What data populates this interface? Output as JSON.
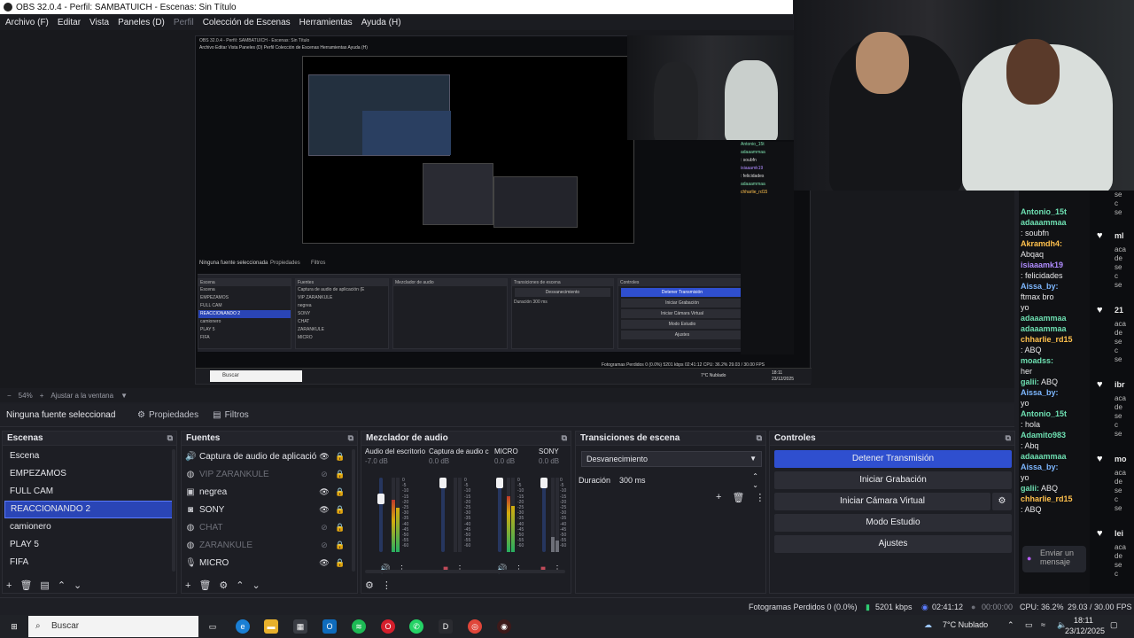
{
  "window": {
    "title": "OBS 32.0.4 - Perfil: SAMBATUICH - Escenas: Sin Título"
  },
  "menu": [
    "Archivo (F)",
    "Editar",
    "Vista",
    "Paneles (D)",
    "Perfil",
    "Colección de Escenas",
    "Herramientas",
    "Ayuda (H)"
  ],
  "nested": {
    "title": "OBS 32.0.4 - Perfil: SAMBATUICH - Escenas: Sin Título",
    "menu": "Archivo  Editar  Vista  Paneles (D)  Perfil  Colección de Escenas  Herramientas  Ayuda (H)",
    "no_source": "Ninguna fuente seleccionada",
    "properties": "Propiedades",
    "filters": "Filtros",
    "scenes_title": "Escena",
    "scenes": [
      "Escena",
      "EMPEZAMOS",
      "FULL CAM",
      "REACCIONANDO 2",
      "camionero",
      "PLAY 5",
      "FIFA"
    ],
    "sources_title": "Fuentes",
    "sources": [
      "Captura de audio de aplicación (E",
      "VIP ZARANKULE",
      "negrea",
      "SONY",
      "CHAT",
      "ZARANKULE",
      "MICRO"
    ],
    "mixer_title": "Mezclador de audio",
    "transitions_title": "Transiciones de escena",
    "transition": "Desvanecimiento",
    "duration_label": "Duración",
    "duration": "300 ms",
    "controls_title": "Controles",
    "controls": [
      "Detener Transmisión",
      "Iniciar Grabación",
      "Iniciar Cámara Virtual",
      "Modo Estudio",
      "Ajustes"
    ],
    "status": "Fotogramas Perdidos 0 (0.0%)   5201 kbps   02:41:12   CPU: 36.2%   29.03 / 30.00 FPS",
    "search": "Buscar",
    "weather": "7°C  Nublado",
    "time": "18:11",
    "date": "23/12/2025"
  },
  "zoom": {
    "value": "54%",
    "fit": "Ajustar a la ventana"
  },
  "filterbar": {
    "no_source": "Ninguna fuente seleccionad",
    "properties": "Propiedades",
    "filters": "Filtros"
  },
  "scenes": {
    "title": "Escenas",
    "items": [
      "Escena",
      "EMPEZAMOS",
      "FULL CAM",
      "REACCIONANDO 2",
      "camionero",
      "PLAY 5",
      "FIFA"
    ],
    "selected": "REACCIONANDO 2"
  },
  "sources": {
    "title": "Fuentes",
    "items": [
      {
        "name": "Captura de audio de aplicación (E",
        "icon": "speaker-icon",
        "visible": true
      },
      {
        "name": "VIP ZARANKULE",
        "icon": "globe-icon",
        "visible": false
      },
      {
        "name": "negrea",
        "icon": "image-icon",
        "visible": true
      },
      {
        "name": "SONY",
        "icon": "camera-icon",
        "visible": true
      },
      {
        "name": "CHAT",
        "icon": "globe-icon",
        "visible": false
      },
      {
        "name": "ZARANKULE",
        "icon": "globe-icon",
        "visible": false
      },
      {
        "name": "MICRO",
        "icon": "microphone-icon",
        "visible": true
      }
    ]
  },
  "mixer": {
    "title": "Mezclador de audio",
    "channels": [
      {
        "name": "Audio del escritorio",
        "db": "-7.0 dB",
        "level": 0.55,
        "muted": false
      },
      {
        "name": "Captura de audio c",
        "db": "0.0 dB",
        "level": 0.0,
        "muted": true
      },
      {
        "name": "MICRO",
        "db": "0.0 dB",
        "level": 0.7,
        "muted": false
      },
      {
        "name": "SONY",
        "db": "0.0 dB",
        "level": 0.0,
        "muted": true
      }
    ],
    "scale": [
      "0",
      "-5",
      "-10",
      "-15",
      "-20",
      "-25",
      "-30",
      "-35",
      "-40",
      "-45",
      "-50",
      "-55",
      "-60"
    ]
  },
  "transitions": {
    "title": "Transiciones de escena",
    "selected": "Desvanecimiento",
    "duration_label": "Duración",
    "duration": "300 ms"
  },
  "controls": {
    "title": "Controles",
    "stop_stream": "Detener Transmisión",
    "start_recording": "Iniciar Grabación",
    "start_virtual_cam": "Iniciar Cámara Virtual",
    "studio_mode": "Modo Estudio",
    "settings": "Ajustes"
  },
  "status": {
    "dropped": "Fotogramas Perdidos 0 (0.0%)",
    "bitrate": "5201 kbps",
    "stream_time": "02:41:12",
    "rec_time": "00:00:00",
    "cpu": "CPU: 36.2%",
    "fps": "29.03 / 30.00 FPS"
  },
  "chat": {
    "lines": [
      {
        "user": "Antonio_15t",
        "color": "g",
        "text": ""
      },
      {
        "user": "adaaammaa",
        "color": "g",
        "text": ""
      },
      {
        "user": "",
        "color": "",
        "text": ": soubfn"
      },
      {
        "user": "Akramdh4:",
        "color": "o",
        "text": ""
      },
      {
        "user": "",
        "color": "",
        "text": "Abqaq"
      },
      {
        "user": "isiaaamk19",
        "color": "p",
        "text": ""
      },
      {
        "user": "",
        "color": "",
        "text": ": felicidades"
      },
      {
        "user": "Aissa_by:",
        "color": "b",
        "text": ""
      },
      {
        "user": "",
        "color": "",
        "text": "ftmax bro"
      },
      {
        "user": "",
        "color": "",
        "text": "yo"
      },
      {
        "user": "adaaammaa",
        "color": "g",
        "text": ""
      },
      {
        "user": "adaaammaa",
        "color": "g",
        "text": ""
      },
      {
        "user": "chharlie_rd15",
        "color": "o",
        "text": ""
      },
      {
        "user": "",
        "color": "",
        "text": ": ABQ"
      },
      {
        "user": "moadss:",
        "color": "g",
        "text": ""
      },
      {
        "user": "",
        "color": "",
        "text": "her"
      },
      {
        "user": "galii:",
        "color": "g",
        "text": " ABQ"
      },
      {
        "user": "Aissa_by:",
        "color": "b",
        "text": ""
      },
      {
        "user": "",
        "color": "",
        "text": "yo"
      },
      {
        "user": "Antonio_15t",
        "color": "g",
        "text": ""
      },
      {
        "user": "",
        "color": "",
        "text": ": hola"
      },
      {
        "user": "Adamito983",
        "color": "g",
        "text": ""
      },
      {
        "user": "",
        "color": "",
        "text": ": Abq"
      },
      {
        "user": "adaaammaa",
        "color": "g",
        "text": ""
      },
      {
        "user": "Aissa_by:",
        "color": "b",
        "text": ""
      },
      {
        "user": "",
        "color": "",
        "text": "yo"
      },
      {
        "user": "galii:",
        "color": "g",
        "text": " ABQ"
      },
      {
        "user": "chharlie_rd15",
        "color": "o",
        "text": ""
      },
      {
        "user": "",
        "color": "",
        "text": ": ABQ"
      }
    ],
    "input_placeholder": "Enviar un mensaje"
  },
  "side": {
    "top": [
      "se",
      "c",
      "se"
    ],
    "rows": [
      {
        "name": "ml",
        "sub": [
          "aca",
          "de",
          "se",
          "c",
          "se"
        ]
      },
      {
        "name": "21",
        "sub": [
          "aca",
          "de",
          "se",
          "c",
          "se"
        ]
      },
      {
        "name": "ibr",
        "sub": [
          "aca",
          "de",
          "se",
          "c",
          "se"
        ]
      },
      {
        "name": "mo",
        "sub": [
          "aca",
          "de",
          "se",
          "c",
          "se"
        ]
      },
      {
        "name": "lei",
        "sub": [
          "aca",
          "de",
          "se",
          "c"
        ]
      }
    ]
  },
  "taskbar": {
    "search": "Buscar",
    "weather": "7°C  Nublado",
    "time": "18:11",
    "date": "23/12/2025"
  }
}
